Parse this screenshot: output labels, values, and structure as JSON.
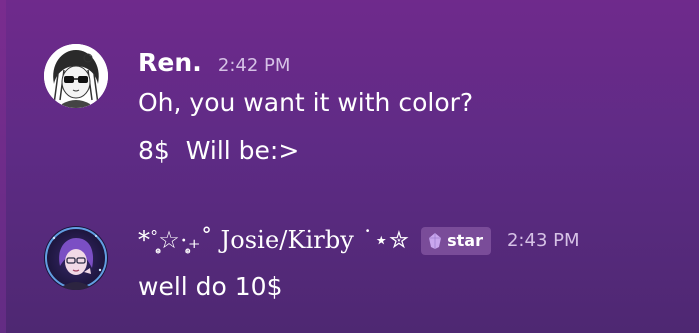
{
  "messages": [
    {
      "avatar": "anime-girl-bw-avatar",
      "username": "Ren.",
      "timestamp": "2:42 PM",
      "lines": [
        "Oh, you want it with color?",
        "8$  Will be:>"
      ]
    },
    {
      "avatar": "anime-girl-purple-avatar",
      "username": "*˚͙̥☆·͙̥₊˚ Josie/Kirby ˙⋆✮",
      "role_badge": {
        "icon": "crystal-icon",
        "label": "star",
        "color": "#7a4c99"
      },
      "timestamp": "2:43 PM",
      "lines": [
        "well do 10$"
      ]
    }
  ],
  "colors": {
    "background": "#5e2b85",
    "text": "#ffffff",
    "timestamp": "#d6c2e6"
  }
}
